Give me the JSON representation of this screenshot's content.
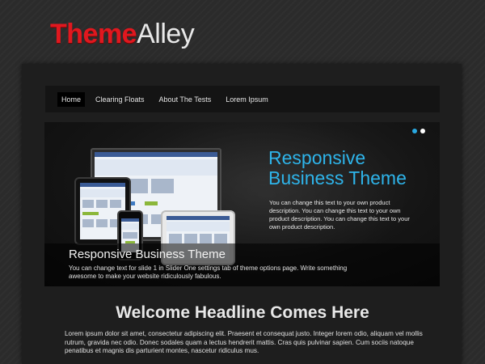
{
  "logo": {
    "part1": "Theme",
    "part2": "Alley"
  },
  "nav": {
    "items": [
      {
        "label": "Home",
        "active": true
      },
      {
        "label": "Clearing Floats",
        "active": false
      },
      {
        "label": "About The Tests",
        "active": false
      },
      {
        "label": "Lorem Ipsum",
        "active": false
      }
    ]
  },
  "slider": {
    "heading": "Responsive Business Theme",
    "description": "You can change this text to your own product description. You can change this text to your own product description. You can change this text to your own product description.",
    "caption_title": "Responsive Business Theme",
    "caption_text": "You can change text for slide 1 in Slider One settings tab of theme options page. Write something awesome to make your website ridiculously fabulous.",
    "active_dot": 1,
    "dot_count": 2,
    "accent_color": "#2eb4ea"
  },
  "main": {
    "headline": "Welcome Headline Comes Here",
    "body": "Lorem ipsum dolor sit amet, consectetur adipiscing elit. Praesent et consequat justo. Integer lorem odio, aliquam vel mollis rutrum, gravida nec odio. Donec sodales quam a lectus hendrerit mattis. Cras quis pulvinar sapien. Cum sociis natoque penatibus et magnis dis parturient montes, nascetur ridiculus mus."
  },
  "colors": {
    "brand_red": "#e0181f",
    "accent_blue": "#2eb4ea",
    "background": "#2b2b2b"
  }
}
